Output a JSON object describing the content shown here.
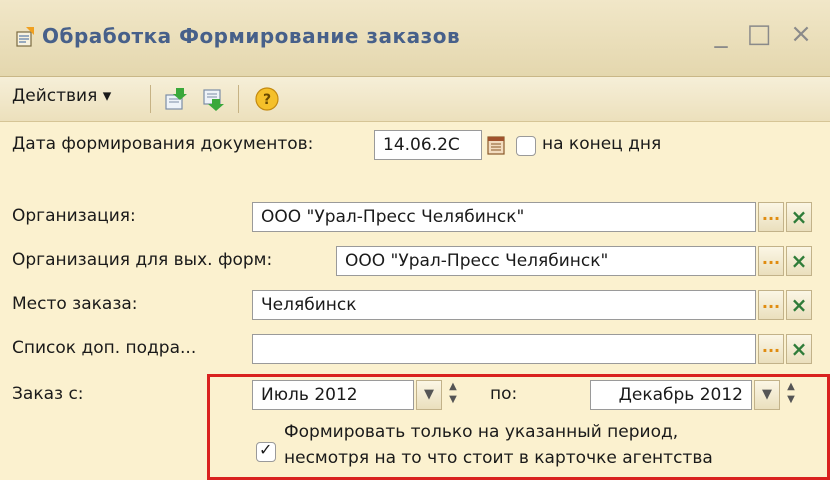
{
  "window": {
    "title": "Обработка  Формирование заказов",
    "controls": [
      "_",
      "□",
      "×"
    ]
  },
  "toolbar": {
    "actions_label": "Действия ▾",
    "icons": [
      "load-icon",
      "save-icon",
      "help-icon"
    ]
  },
  "form": {
    "doc_date": {
      "label": "Дата формирования документов:",
      "value": "14.06.2C",
      "end_of_day_label": "на конец дня",
      "end_of_day_checked": false
    },
    "org": {
      "label": "Организация:",
      "value": "ООО \"Урал-Пресс Челябинск\""
    },
    "org_out": {
      "label": "Организация для вых. форм:",
      "value": "ООО \"Урал-Пресс Челябинск\""
    },
    "place": {
      "label": "Место заказа:",
      "value": "Челябинск"
    },
    "subdiv": {
      "label": "Список доп. подра...",
      "value": ""
    },
    "period": {
      "label": "Заказ с:",
      "from": "Июль 2012",
      "to_label": "по:",
      "to": "Декабрь 2012",
      "only_period_checked": true,
      "only_period_line1": "Формировать только на указанный период,",
      "only_period_line2": "несмотря на то что стоит в карточке агентства"
    }
  },
  "colors": {
    "highlight": "#d9221f",
    "background": "#fbf1cf",
    "title_text": "#47608a"
  }
}
